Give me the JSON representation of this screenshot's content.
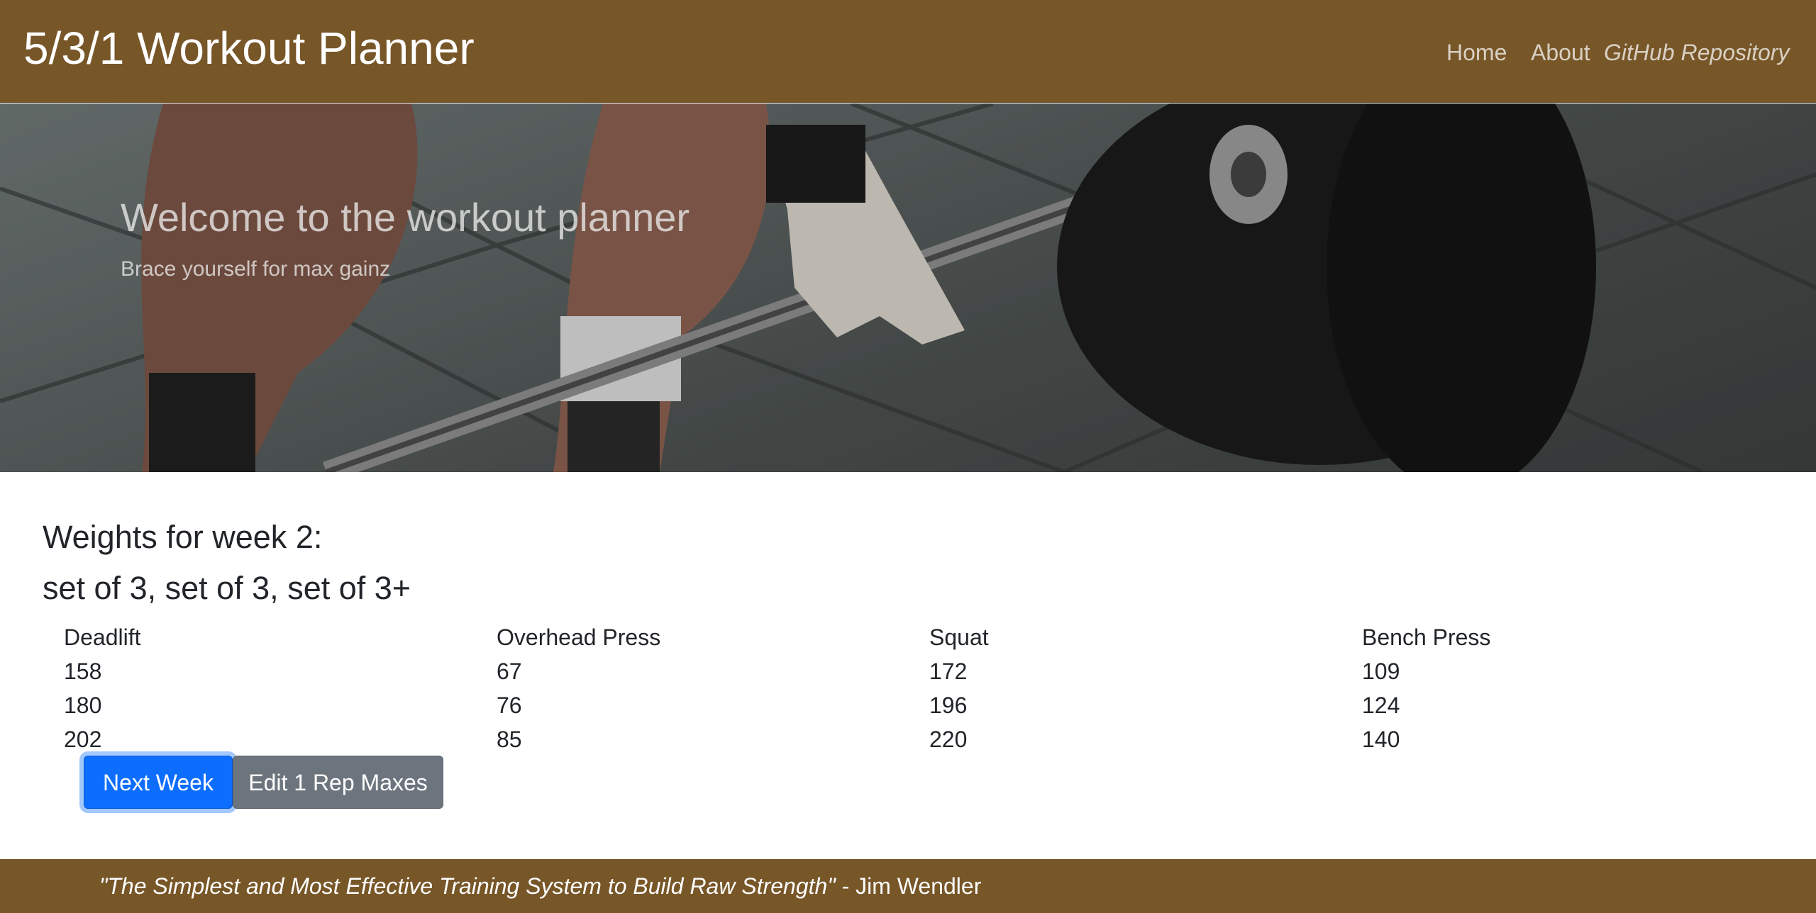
{
  "navbar": {
    "brand": "5/3/1 Workout Planner",
    "links": {
      "home": "Home",
      "about": "About",
      "github": "GitHub Repository"
    }
  },
  "hero": {
    "title": "Welcome to the workout planner",
    "subtitle": "Brace yourself for max gainz"
  },
  "weights": {
    "heading": "Weights for week 2:",
    "sets": "set of 3, set of 3, set of 3+",
    "columns": [
      {
        "lift": "Deadlift",
        "values": [
          "158",
          "180",
          "202"
        ]
      },
      {
        "lift": "Overhead Press",
        "values": [
          "67",
          "76",
          "85"
        ]
      },
      {
        "lift": "Squat",
        "values": [
          "172",
          "196",
          "220"
        ]
      },
      {
        "lift": "Bench Press",
        "values": [
          "109",
          "124",
          "140"
        ]
      }
    ]
  },
  "buttons": {
    "next_week": "Next Week",
    "edit_maxes": "Edit 1 Rep Maxes"
  },
  "footer": {
    "quote": "\"The Simplest and Most Effective Training System to Build Raw Strength\"",
    "author": " - Jim Wendler"
  },
  "colors": {
    "navbar_bg": "#775628",
    "primary": "#0d6efd",
    "secondary": "#6c757d"
  }
}
